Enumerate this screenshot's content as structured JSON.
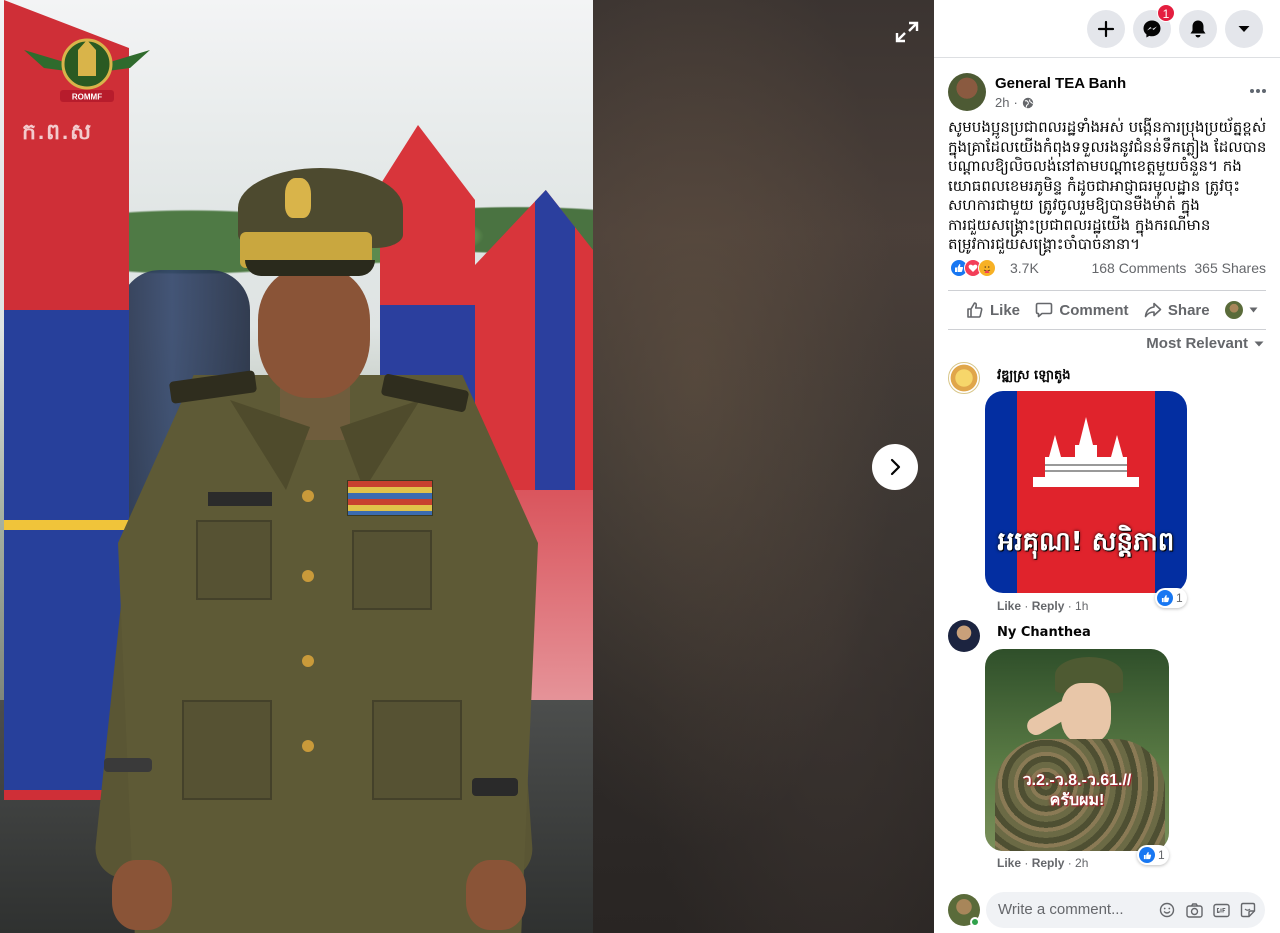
{
  "viewer": {
    "watermark_text": "ក.ព.ស",
    "emblem_caption": "ROMMF"
  },
  "topbar": {
    "notification_count": "1",
    "icons": [
      "plus-icon",
      "messenger-icon",
      "bell-icon",
      "caret-down-icon"
    ]
  },
  "post": {
    "author": "General TEA Banh",
    "time": "2h",
    "privacy_icon": "globe-icon",
    "text": "សូមបងប្អូនប្រជាពលរដ្ឋទាំងអស់ បង្កើនការប្រុងប្រយ័ត្នខ្ពស់ ក្នុងគ្រាដែលយើងកំពុងទទួលរងនូវជំនន់ទឹកភ្លៀង ដែលបានបណ្តាលឱ្យលិចលង់នៅតាមបណ្តាខេត្តមួយចំនួន។ កងយោធពលខេមរភូមិន្ទ កំដូចជាអាជ្ញាធរមូលដ្ឋាន ត្រូវចុះសហការជាមួយ ត្រូវចូលរួមឱ្យបានមឺងម៉ាត់ ក្នុងការជួយសង្គ្រោះប្រជាពលរដ្ឋយើង ក្នុងករណីមានតម្រូវការជួយសង្គ្រោះចាំបាច់នានា។",
    "reaction_count": "3.7K",
    "comments_count": "168 Comments",
    "shares_count": "365 Shares"
  },
  "actions": {
    "like": "Like",
    "comment": "Comment",
    "share": "Share"
  },
  "sort_label": "Most Relevant",
  "comments": [
    {
      "name": "វឌ្ឍស្រ ឡោតូង",
      "image_caption": "អរគុណ! សន្តិភាព",
      "like": "Like",
      "reply": "Reply",
      "time": "1h",
      "reaction_count": "1"
    },
    {
      "name": "Ny Chanthea",
      "image_caption_line1": "ว.2.-ว.8.-ว.61.//",
      "image_caption_line2": "ครับผม!",
      "like": "Like",
      "reply": "Reply",
      "time": "2h",
      "reaction_count": "1"
    }
  ],
  "write_comment": {
    "placeholder": "Write a comment...",
    "icons": [
      "emoji-icon",
      "camera-icon",
      "gif-icon",
      "sticker-icon"
    ]
  },
  "colors": {
    "facebook_blue": "#1877f2",
    "cambodia_red": "#e0232c",
    "cambodia_blue": "#032ea1"
  }
}
